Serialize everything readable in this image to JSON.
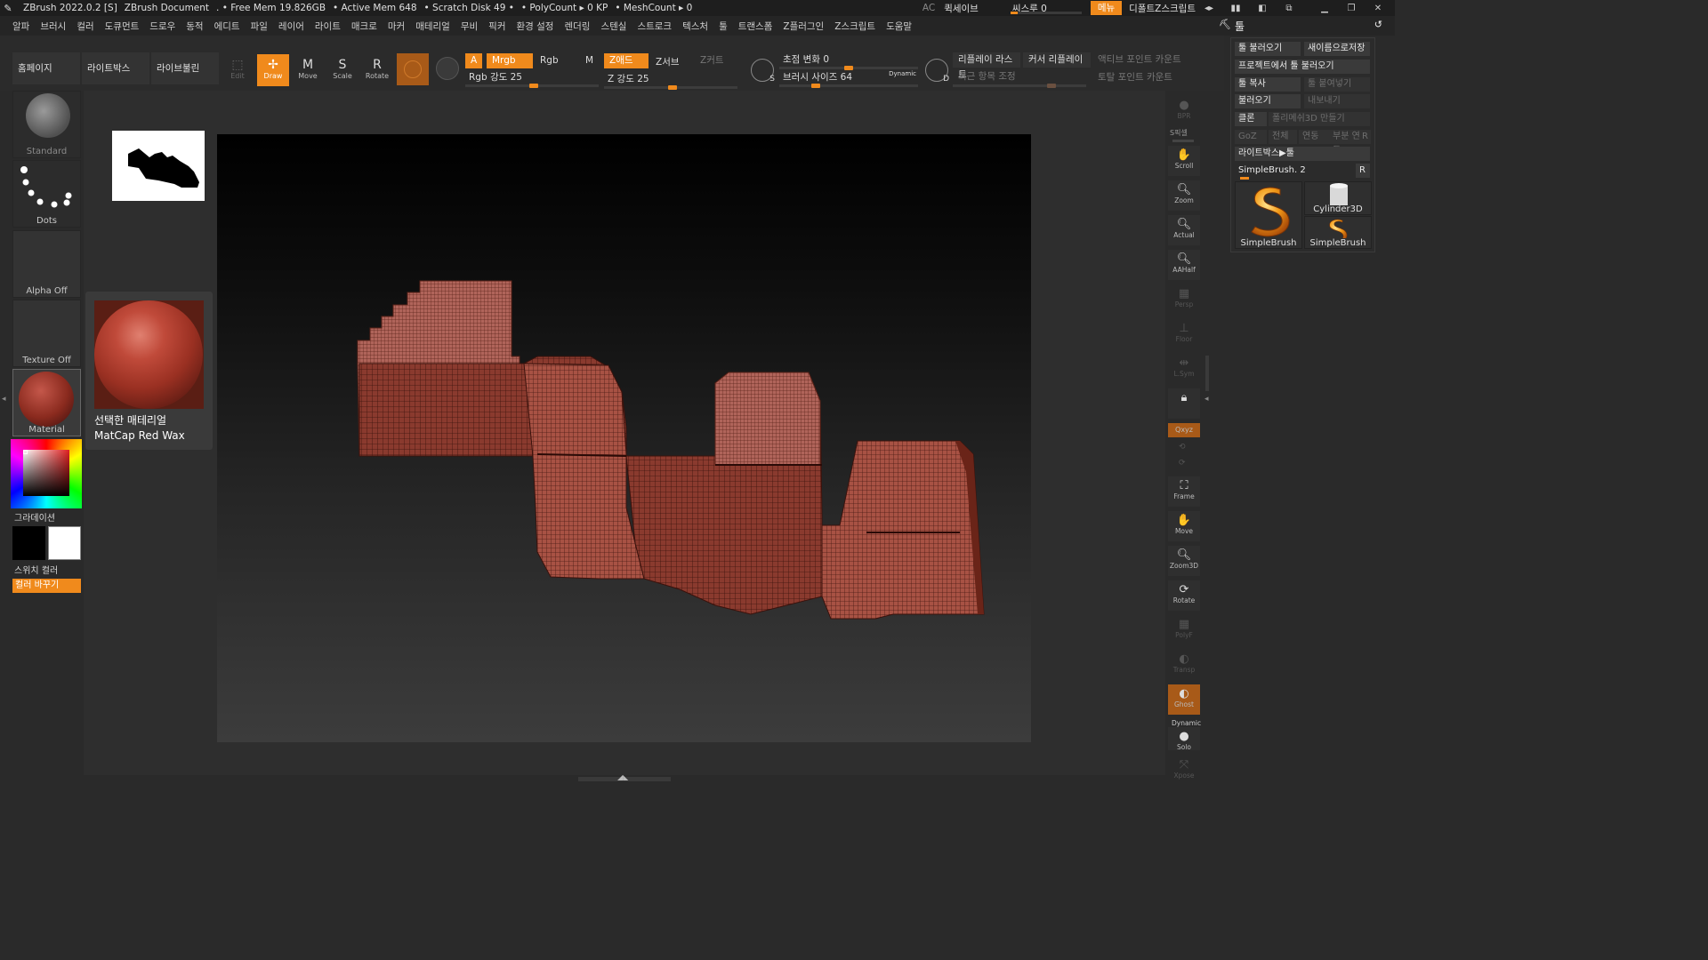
{
  "titlebar": {
    "app": "ZBrush 2022.0.2 [S]",
    "document": "ZBrush Document",
    "free_mem": ". • Free Mem 19.826GB",
    "active_mem": "• Active Mem 648",
    "scratch": "• Scratch Disk 49 •",
    "polycount": "• PolyCount ▸ 0 KP",
    "meshcount": "• MeshCount ▸ 0",
    "ac": "AC",
    "quicksave": "퀵세이브",
    "see_through": "씨스루 0",
    "see_through_value": 0,
    "menu_btn": "메뉴",
    "default_zscript": "디폴트Z스크립트"
  },
  "menubar": {
    "items": [
      "알파",
      "브러시",
      "컬러",
      "도큐먼트",
      "드로우",
      "동적",
      "에디트",
      "파일",
      "레이어",
      "라이트",
      "매크로",
      "마커",
      "매테리얼",
      "무비",
      "픽커",
      "환경 설정",
      "렌더링",
      "스텐실",
      "스트로크",
      "텍스처",
      "툴",
      "트랜스폼",
      "Z플러그인",
      "Z스크립트",
      "도움말"
    ],
    "tool_title": "툴"
  },
  "shelf": {
    "home": "홈페이지",
    "lightbox": "라이트박스",
    "livebool": "라이브불린",
    "tools": [
      {
        "label": "Edit",
        "glyph": "⬚"
      },
      {
        "label": "Draw",
        "glyph": "✎"
      },
      {
        "label": "Move",
        "glyph": "M"
      },
      {
        "label": "Scale",
        "glyph": "S"
      },
      {
        "label": "Rotate",
        "glyph": "R"
      }
    ],
    "a": "A",
    "mrgb": "Mrgb",
    "rgb": "Rgb",
    "m": "M",
    "zadd": "Z애드",
    "zsub": "Z서브",
    "zcut": "Z커트",
    "rgb_intensity": "Rgb 강도 25",
    "rgb_intensity_value": 25,
    "z_intensity": "Z 강도 25",
    "z_intensity_value": 25,
    "focal_shift": "초점 변화 0",
    "focal_shift_value": 0,
    "draw_size": "브러시 사이즈 64",
    "draw_size_value": 64,
    "dynamic": "Dynamic",
    "replay_last": "리플레이 라스트",
    "cursor_replay": "커서 리플레이",
    "recent_adjust": "최근 항목 조정",
    "active_points": "액티브 포인트 카운트",
    "total_points": "토탈 포인트 카운트",
    "s_label": "S",
    "d_label": "D"
  },
  "left": {
    "brush_label": "Standard",
    "stroke_label": "Dots",
    "alpha_label": "Alpha Off",
    "texture_label": "Texture Off",
    "material_label": "Material",
    "gradient": "그라데이션",
    "switch_color": "스위치 컬러",
    "color_change": "컬러 바꾸기"
  },
  "material_popup": {
    "title": "선택한 매테리얼",
    "name": "MatCap Red Wax"
  },
  "rightdock": {
    "bpr": "BPR",
    "spix": "S픽셀",
    "scroll": "Scroll",
    "zoom": "Zoom",
    "actual": "Actual",
    "aahalf": "AAHalf",
    "persp": "Persp",
    "floor": "Floor",
    "lsym": "L.Sym",
    "qxyz": "Qxyz",
    "frame": "Frame",
    "move": "Move",
    "zoom3d": "Zoom3D",
    "rotate": "Rotate",
    "polyf": "PolyF",
    "transp": "Transp",
    "ghost": "Ghost",
    "dynamic": "Dynamic",
    "solo": "Solo",
    "xpose": "Xpose"
  },
  "toolpalette": {
    "load_tool": "툴 불러오기",
    "save_as": "새이름으로저장",
    "load_from_project": "프로젝트에서 툴 불러오기",
    "copy_tool": "툴 복사",
    "paste_tool": "툴 붙여넣기",
    "import": "불러오기",
    "export": "내보내기",
    "clone": "클론",
    "make_polymesh": "폴리메쉬3D 만들기",
    "goz": "GoZ",
    "all": "전체",
    "visible": "연동",
    "partial": "부분 연동",
    "r": "R",
    "lightbox_tools": "라이트박스▶툴",
    "current_tool": "SimpleBrush. 2",
    "thumb1": "SimpleBrush",
    "thumb2": "Cylinder3D",
    "thumb3": "SimpleBrush"
  }
}
